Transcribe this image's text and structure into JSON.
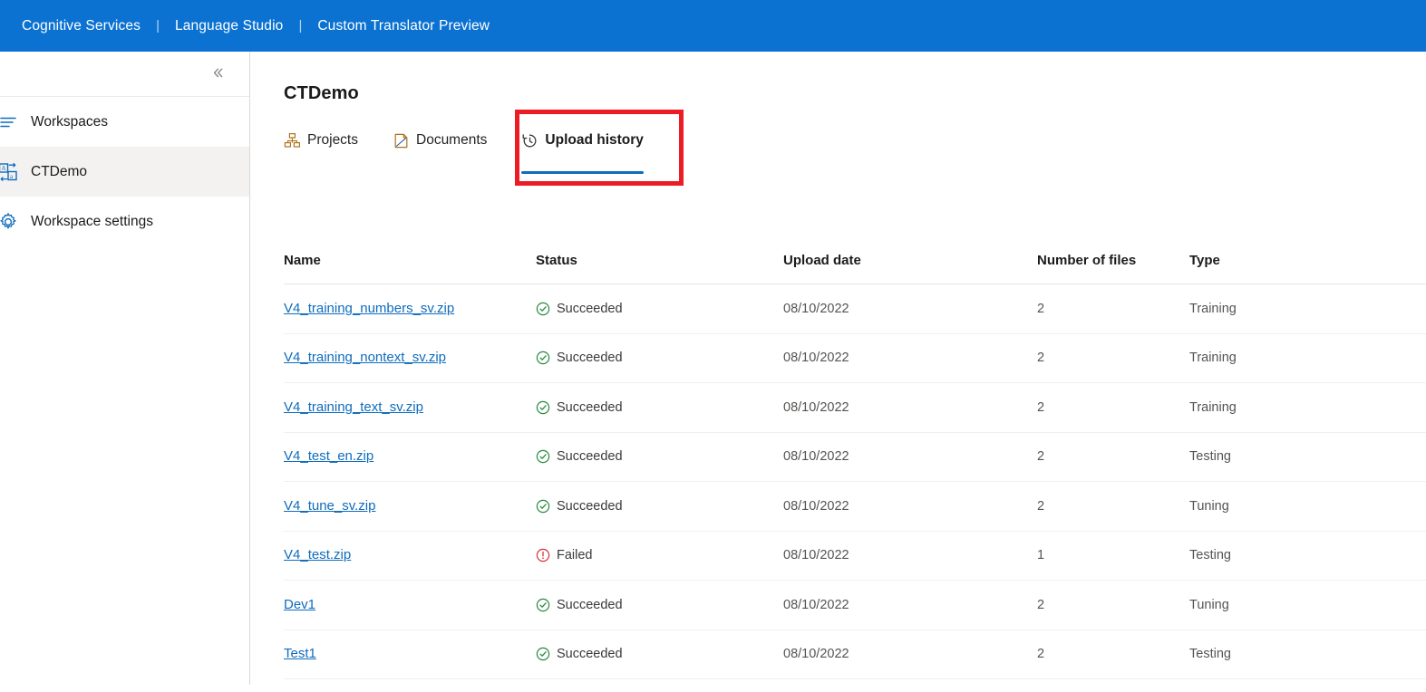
{
  "header": {
    "breadcrumbs": [
      {
        "label": "Cognitive Services"
      },
      {
        "label": "Language Studio"
      },
      {
        "label": "Custom Translator Preview"
      }
    ],
    "separator": "|",
    "background_color": "#0b72d2"
  },
  "sidebar": {
    "collapse_icon": "chevron-double-left-icon",
    "items": [
      {
        "label": "Workspaces",
        "icon": "list-icon",
        "selected": false
      },
      {
        "label": "CTDemo",
        "icon": "translate-icon",
        "selected": true
      },
      {
        "label": "Workspace settings",
        "icon": "gear-icon",
        "selected": false
      }
    ]
  },
  "main": {
    "title": "CTDemo",
    "tabs": [
      {
        "label": "Projects",
        "icon": "projects-icon",
        "active": false
      },
      {
        "label": "Documents",
        "icon": "document-icon",
        "active": false
      },
      {
        "label": "Upload history",
        "icon": "history-icon",
        "active": true
      }
    ],
    "annotation": {
      "shape": "rectangle",
      "color": "#ec1c24",
      "targets": "Upload history"
    }
  },
  "table": {
    "columns": [
      "Name",
      "Status",
      "Upload date",
      "Number of files",
      "Type"
    ],
    "rows": [
      {
        "name": "V4_training_numbers_sv.zip",
        "status": "Succeeded",
        "status_kind": "success",
        "date": "08/10/2022",
        "files": "2",
        "type": "Training"
      },
      {
        "name": "V4_training_nontext_sv.zip",
        "status": "Succeeded",
        "status_kind": "success",
        "date": "08/10/2022",
        "files": "2",
        "type": "Training"
      },
      {
        "name": "V4_training_text_sv.zip",
        "status": "Succeeded",
        "status_kind": "success",
        "date": "08/10/2022",
        "files": "2",
        "type": "Training"
      },
      {
        "name": "V4_test_en.zip",
        "status": "Succeeded",
        "status_kind": "success",
        "date": "08/10/2022",
        "files": "2",
        "type": "Testing"
      },
      {
        "name": "V4_tune_sv.zip",
        "status": "Succeeded",
        "status_kind": "success",
        "date": "08/10/2022",
        "files": "2",
        "type": "Tuning"
      },
      {
        "name": "V4_test.zip",
        "status": "Failed",
        "status_kind": "error",
        "date": "08/10/2022",
        "files": "1",
        "type": "Testing"
      },
      {
        "name": "Dev1",
        "status": "Succeeded",
        "status_kind": "success",
        "date": "08/10/2022",
        "files": "2",
        "type": "Tuning"
      },
      {
        "name": "Test1",
        "status": "Succeeded",
        "status_kind": "success",
        "date": "08/10/2022",
        "files": "2",
        "type": "Testing"
      }
    ]
  },
  "colors": {
    "brand_blue": "#0b72d2",
    "link_blue": "#0f6cbd",
    "success_green": "#2a8a3e",
    "error_red": "#d13438",
    "annotation_red": "#ec1c24",
    "selected_gray": "#f3f2f1"
  }
}
